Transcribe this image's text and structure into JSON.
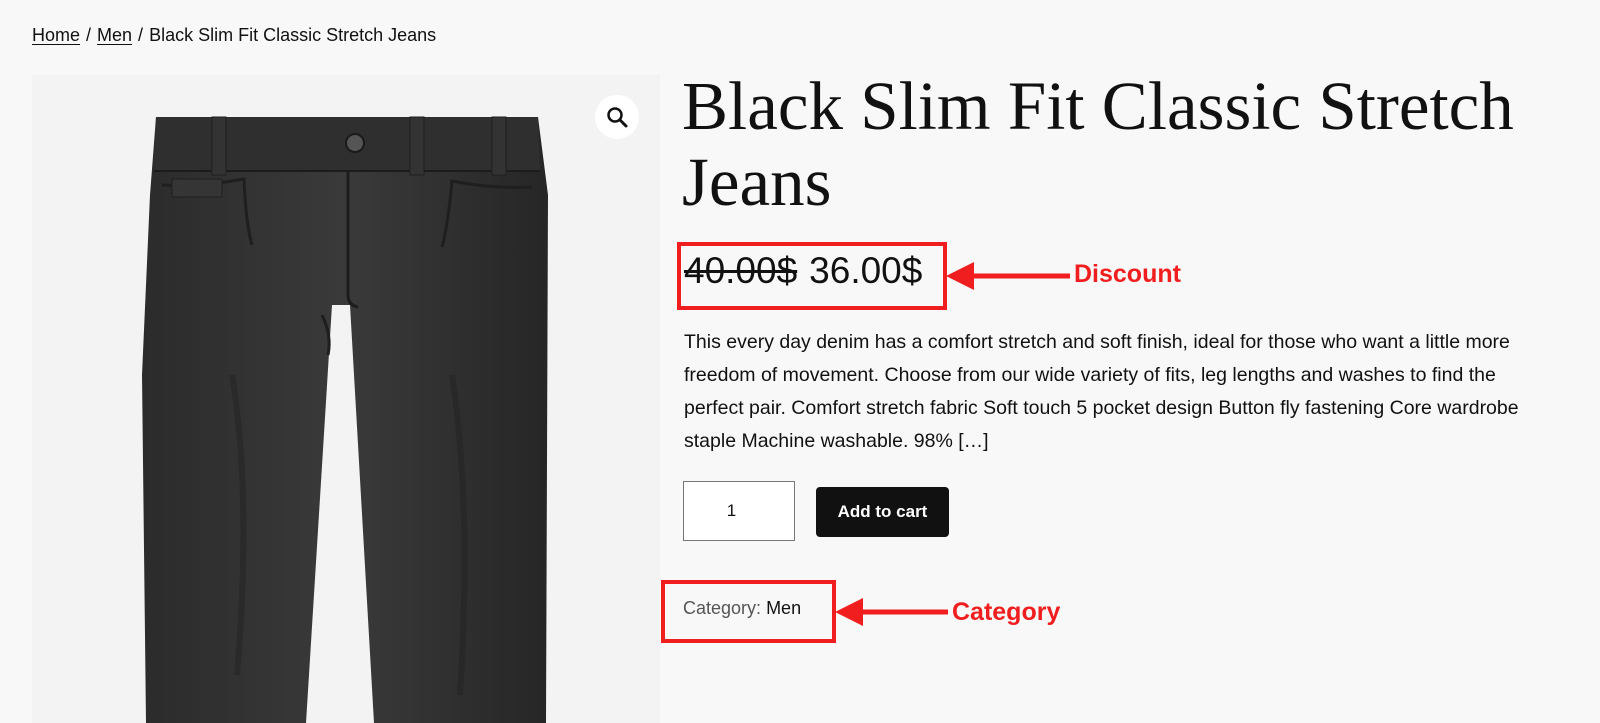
{
  "breadcrumb": {
    "home": "Home",
    "sep1": "/",
    "men": "Men",
    "sep2": "/",
    "current": "Black Slim Fit Classic Stretch Jeans"
  },
  "gallery": {
    "zoom_icon": "magnifier-icon",
    "image_subject": "black slim fit jeans"
  },
  "product": {
    "title": "Black Slim Fit Classic Stretch Jeans",
    "price_old": "40.00$",
    "price_new": "36.00$",
    "description": "This every day denim has a comfort stretch and soft finish, ideal for those who want a little more freedom of movement. Choose from our wide variety of fits, leg lengths and washes to find the perfect pair. Comfort stretch fabric Soft touch 5 pocket design Button fly fastening Core wardrobe staple Machine washable. 98% […]",
    "quantity": "1",
    "add_to_cart": "Add to cart",
    "category_label": "Category:",
    "category_value": "Men"
  },
  "annotations": {
    "discount": "Discount",
    "category": "Category",
    "color": "#f01e1e"
  }
}
